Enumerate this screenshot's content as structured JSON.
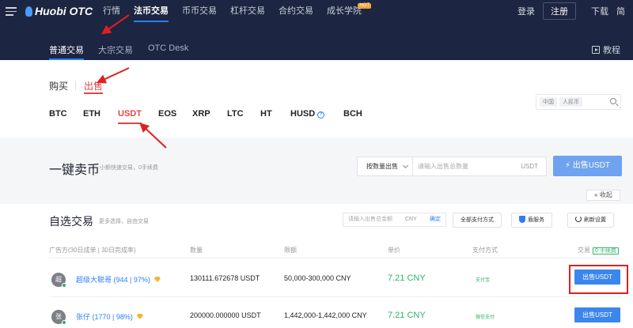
{
  "nav": {
    "logo": "Huobi OTC",
    "links": [
      "行情",
      "法币交易",
      "币币交易",
      "杠杆交易",
      "合约交易",
      "成长学院"
    ],
    "hot_badge": "HOT",
    "login": "登录",
    "register": "注册",
    "download": "下载",
    "truncated": "简"
  },
  "subnav": {
    "tabs": [
      "普通交易",
      "大宗交易",
      "OTC Desk"
    ],
    "tutorial": "教程"
  },
  "trade": {
    "buy": "购买",
    "sell": "出售",
    "coins": [
      "BTC",
      "ETH",
      "USDT",
      "EOS",
      "XRP",
      "LTC",
      "HT",
      "HUSD",
      "BCH"
    ],
    "region": "中国",
    "currency": "人民币"
  },
  "quick_sell": {
    "title": "一键卖币",
    "subtitle": "小额快速交易，0手续费",
    "select": "按数量出售",
    "placeholder": "请输入出售总数量",
    "unit": "USDT",
    "button": "出售USDT"
  },
  "collapse": "收起",
  "list": {
    "title": "自选交易",
    "subtitle": "更多选择，自由交易",
    "amount_placeholder": "请输入出售总金额",
    "amount_unit": "CNY",
    "amount_confirm": "确定",
    "all_payment": "全部支付方式",
    "shield_service": "盾服务",
    "refresh": "刷新设置",
    "columns": {
      "merchant": "广告方(30日成单 | 30日完成率)",
      "qty": "数量",
      "limit": "限额",
      "price": "单价",
      "payment": "支付方式",
      "action": "交易",
      "fee": "0 手续费"
    },
    "rows": [
      {
        "avatar": "超",
        "merchant": "超级大聪哥 (944 | 97%)",
        "qty": "130111.672678 USDT",
        "limit": "50,000-300,000 CNY",
        "price": "7.21 CNY",
        "payment": "支付宝",
        "action": "出售USDT"
      },
      {
        "avatar": "张",
        "merchant": "张仔 (1770 | 98%)",
        "qty": "200000.000000 USDT",
        "limit": "1,442,000-1,442,000 CNY",
        "price": "7.21 CNY",
        "payment": "微信支付",
        "action": "出售USDT"
      }
    ]
  }
}
